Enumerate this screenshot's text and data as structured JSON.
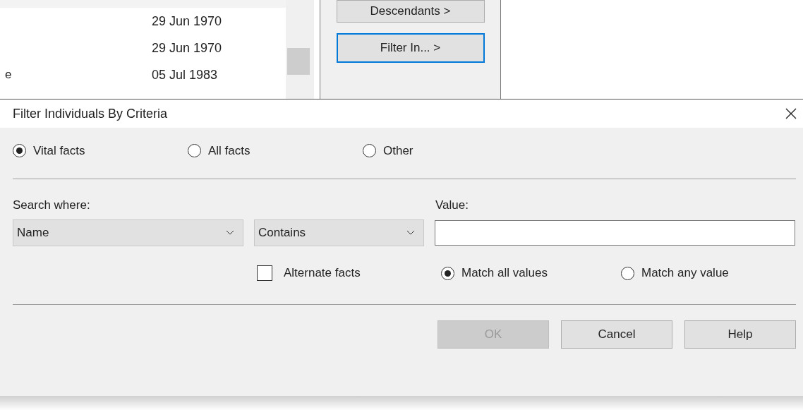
{
  "background": {
    "list_rows": [
      {
        "date": "29 Jun 1970"
      },
      {
        "date": "29 Jun 1970"
      },
      {
        "column_1": "e",
        "date": "05 Jul 1983"
      }
    ],
    "buttons": [
      {
        "label": "Descendants >",
        "focused": false
      },
      {
        "label": "Filter In... >",
        "focused": true
      }
    ]
  },
  "dialog": {
    "title": "Filter Individuals By Criteria",
    "scope_options": [
      {
        "label": "Vital facts",
        "selected": true
      },
      {
        "label": "All facts",
        "selected": false
      },
      {
        "label": "Other",
        "selected": false
      }
    ],
    "search_where": {
      "label": "Search where:",
      "value": "Name"
    },
    "operator": {
      "value": "Contains"
    },
    "value_field": {
      "label": "Value:"
    },
    "alternate_facts": {
      "label": "Alternate facts",
      "checked": false
    },
    "match_options": [
      {
        "label": "Match all values",
        "selected": true
      },
      {
        "label": "Match any value",
        "selected": false
      }
    ],
    "buttons": [
      {
        "label": "OK",
        "disabled": true
      },
      {
        "label": "Cancel",
        "disabled": false
      },
      {
        "label": "Help",
        "disabled": false
      }
    ]
  }
}
